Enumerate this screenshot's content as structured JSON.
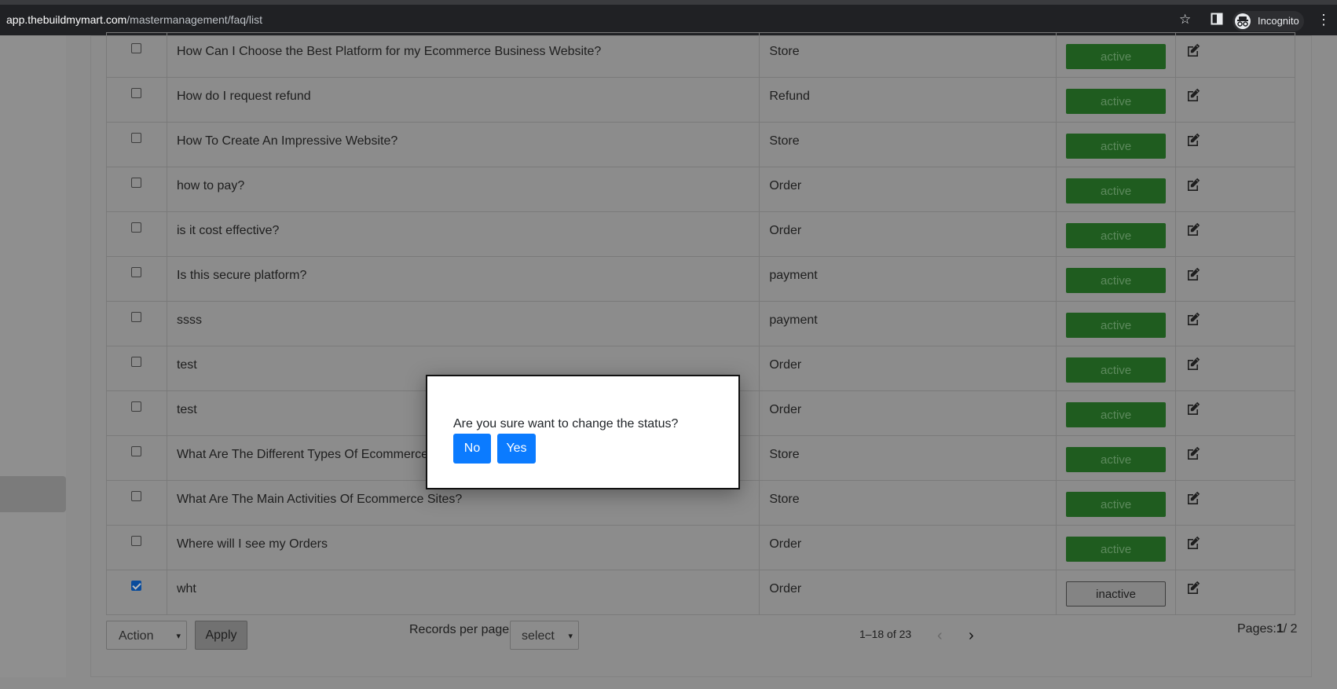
{
  "browser": {
    "url_host": "app.thebuildmymart.com",
    "url_path": "/mastermanagement/faq/list",
    "incognito_label": "Incognito",
    "icons": [
      "star-icon",
      "side-panel-icon",
      "incognito-icon",
      "kebab-menu-icon"
    ]
  },
  "table": {
    "rows": [
      {
        "question": "How Can I Choose the Best Platform for my Ecommerce Business Website?",
        "category": "Store",
        "status": "active",
        "checked": false
      },
      {
        "question": "How do I request refund",
        "category": "Refund",
        "status": "active",
        "checked": false
      },
      {
        "question": "How To Create An Impressive Website?",
        "category": "Store",
        "status": "active",
        "checked": false
      },
      {
        "question": "how to pay?",
        "category": "Order",
        "status": "active",
        "checked": false
      },
      {
        "question": "is it cost effective?",
        "category": "Order",
        "status": "active",
        "checked": false
      },
      {
        "question": "Is this secure platform?",
        "category": "payment",
        "status": "active",
        "checked": false
      },
      {
        "question": "ssss",
        "category": "payment",
        "status": "active",
        "checked": false
      },
      {
        "question": "test",
        "category": "Order",
        "status": "active",
        "checked": false
      },
      {
        "question": "test",
        "category": "Order",
        "status": "active",
        "checked": false
      },
      {
        "question": "What Are The Different Types Of Ecommerce?",
        "category": "Store",
        "status": "active",
        "checked": false
      },
      {
        "question": "What Are The Main Activities Of Ecommerce Sites?",
        "category": "Store",
        "status": "active",
        "checked": false
      },
      {
        "question": "Where will I see my Orders",
        "category": "Order",
        "status": "active",
        "checked": false
      },
      {
        "question": "wht",
        "category": "Order",
        "status": "inactive",
        "checked": true
      }
    ]
  },
  "footer": {
    "action_select": "Action",
    "apply_label": "Apply",
    "records_label": "Records per page:",
    "records_select": "select",
    "range_label": "1–18 of 23",
    "prev_label": "‹",
    "next_label": "›",
    "pages_prefix": "Pages:",
    "pages_current": "1",
    "pages_total": "/ 2"
  },
  "modal": {
    "message": "Are you sure want to change the status?",
    "no_label": "No",
    "yes_label": "Yes"
  },
  "colors": {
    "active_badge": "#1f5c1f",
    "modal_button": "#0b7bff",
    "overlay_dim": "#8c8c8c"
  }
}
